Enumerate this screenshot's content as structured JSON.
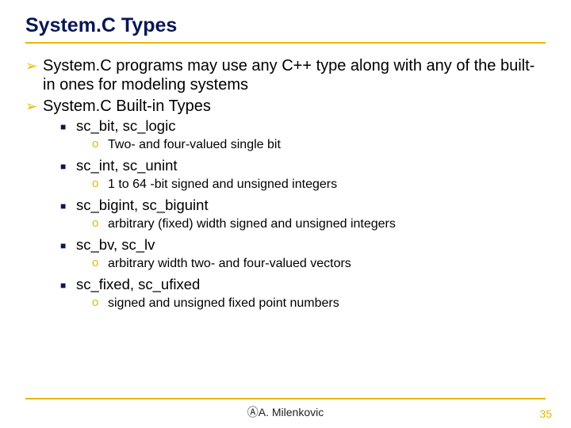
{
  "title": "System.C Types",
  "bullets": [
    {
      "level": 1,
      "text": "System.C programs may use any C++ type along with any of the built-in ones for modeling systems"
    },
    {
      "level": 1,
      "text": "System.C Built-in Types"
    },
    {
      "level": 2,
      "text": "sc_bit, sc_logic"
    },
    {
      "level": 3,
      "text": "Two- and four-valued single bit"
    },
    {
      "level": 2,
      "text": "sc_int, sc_unint"
    },
    {
      "level": 3,
      "text": "1 to 64 -bit signed and unsigned integers"
    },
    {
      "level": 2,
      "text": "sc_bigint, sc_biguint"
    },
    {
      "level": 3,
      "text": "arbitrary (fixed) width signed and unsigned integers"
    },
    {
      "level": 2,
      "text": "sc_bv, sc_lv"
    },
    {
      "level": 3,
      "text": "arbitrary width two- and four-valued vectors"
    },
    {
      "level": 2,
      "text": "sc_fixed, sc_ufixed"
    },
    {
      "level": 3,
      "text": "signed and unsigned fixed point numbers"
    }
  ],
  "footer": {
    "copy_symbol": "Ⓐ",
    "author": "A. Milenkovic",
    "page": "35"
  }
}
